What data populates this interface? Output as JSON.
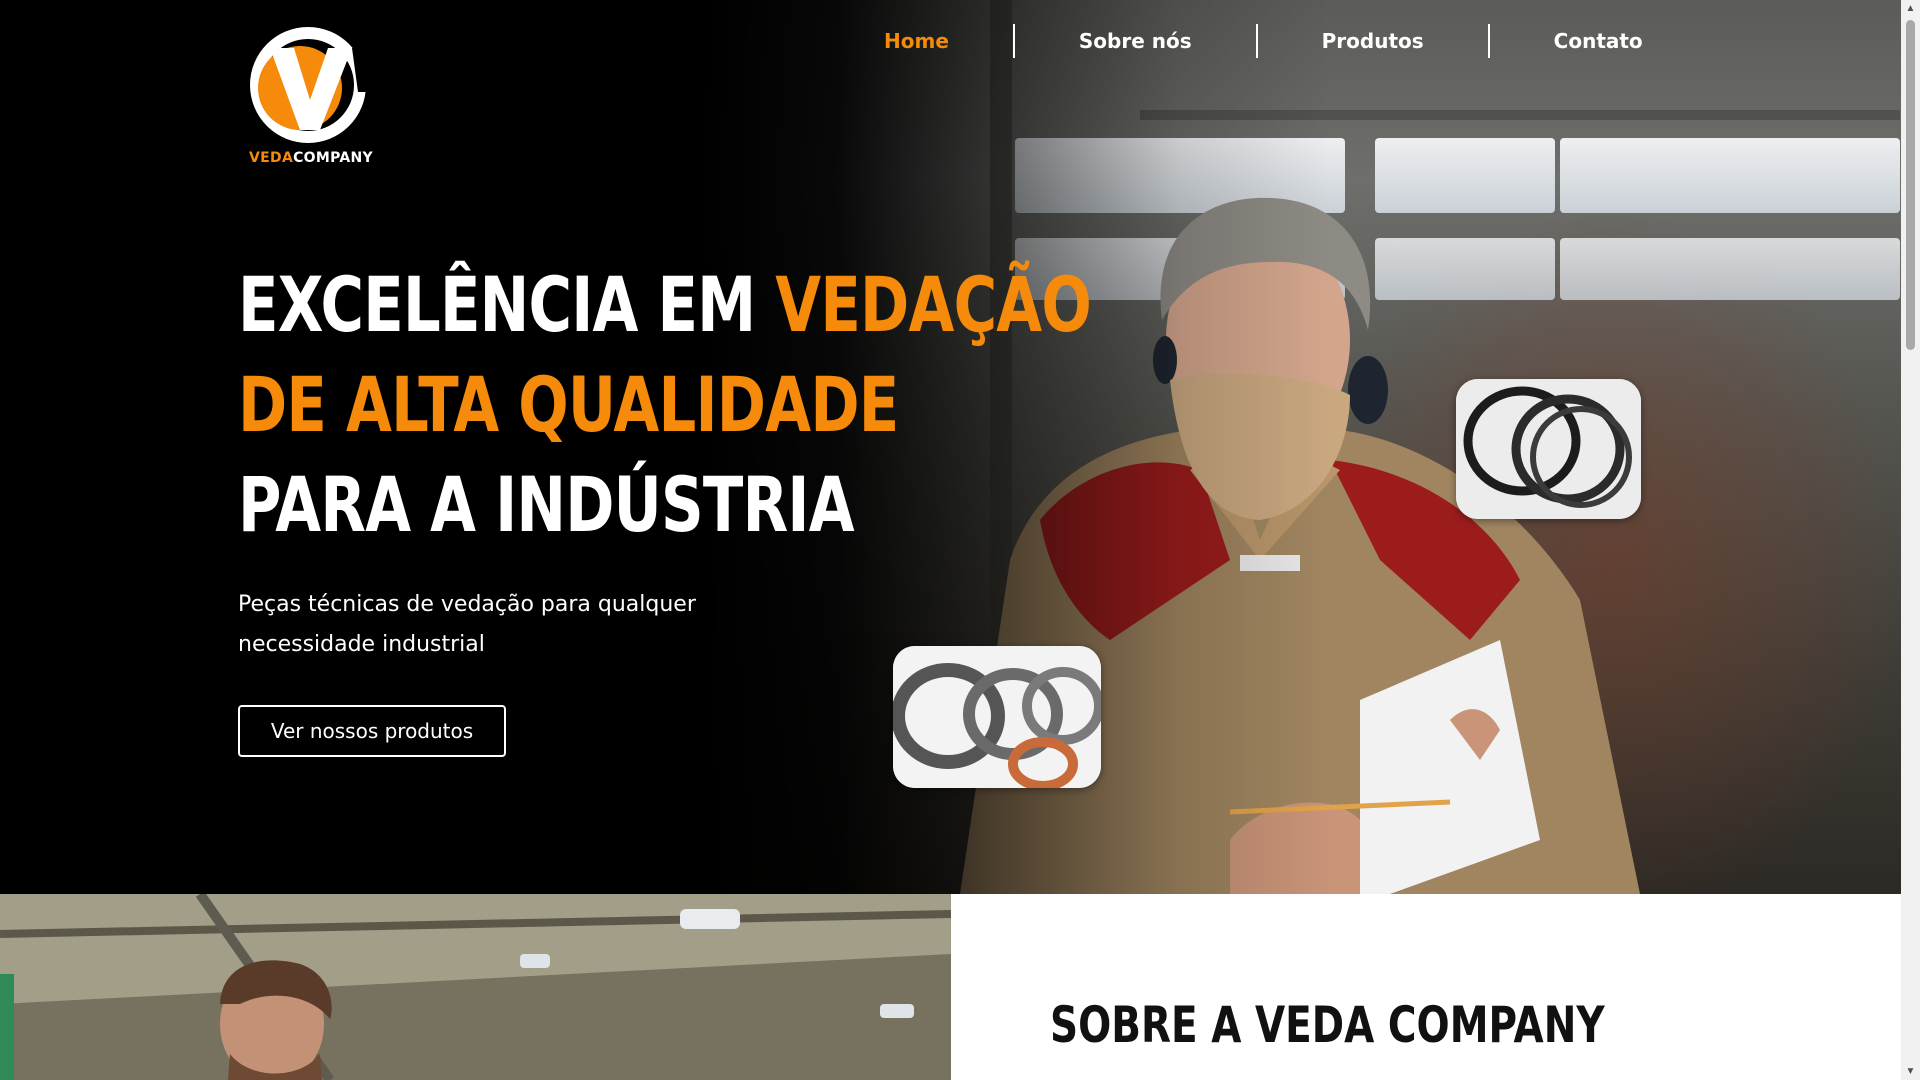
{
  "brand": {
    "name_part1": "VEDA",
    "name_part2": "COMPANY",
    "primary_color": "#f58a0b"
  },
  "nav": {
    "items": [
      {
        "label": "Home",
        "active": true
      },
      {
        "label": "Sobre nós",
        "active": false
      },
      {
        "label": "Produtos",
        "active": false
      },
      {
        "label": "Contato",
        "active": false
      }
    ]
  },
  "hero": {
    "title_line1_white": "EXCELÊNCIA EM ",
    "title_line1_orange": "VEDAÇÃO",
    "title_line2": "DE ALTA QUALIDADE",
    "title_line3": "PARA A INDÚSTRIA",
    "subtitle": "Peças técnicas de vedação para qualquer necessidade industrial",
    "cta_label": "Ver nossos produtos"
  },
  "about": {
    "title": "SOBRE A VEDA COMPANY"
  }
}
